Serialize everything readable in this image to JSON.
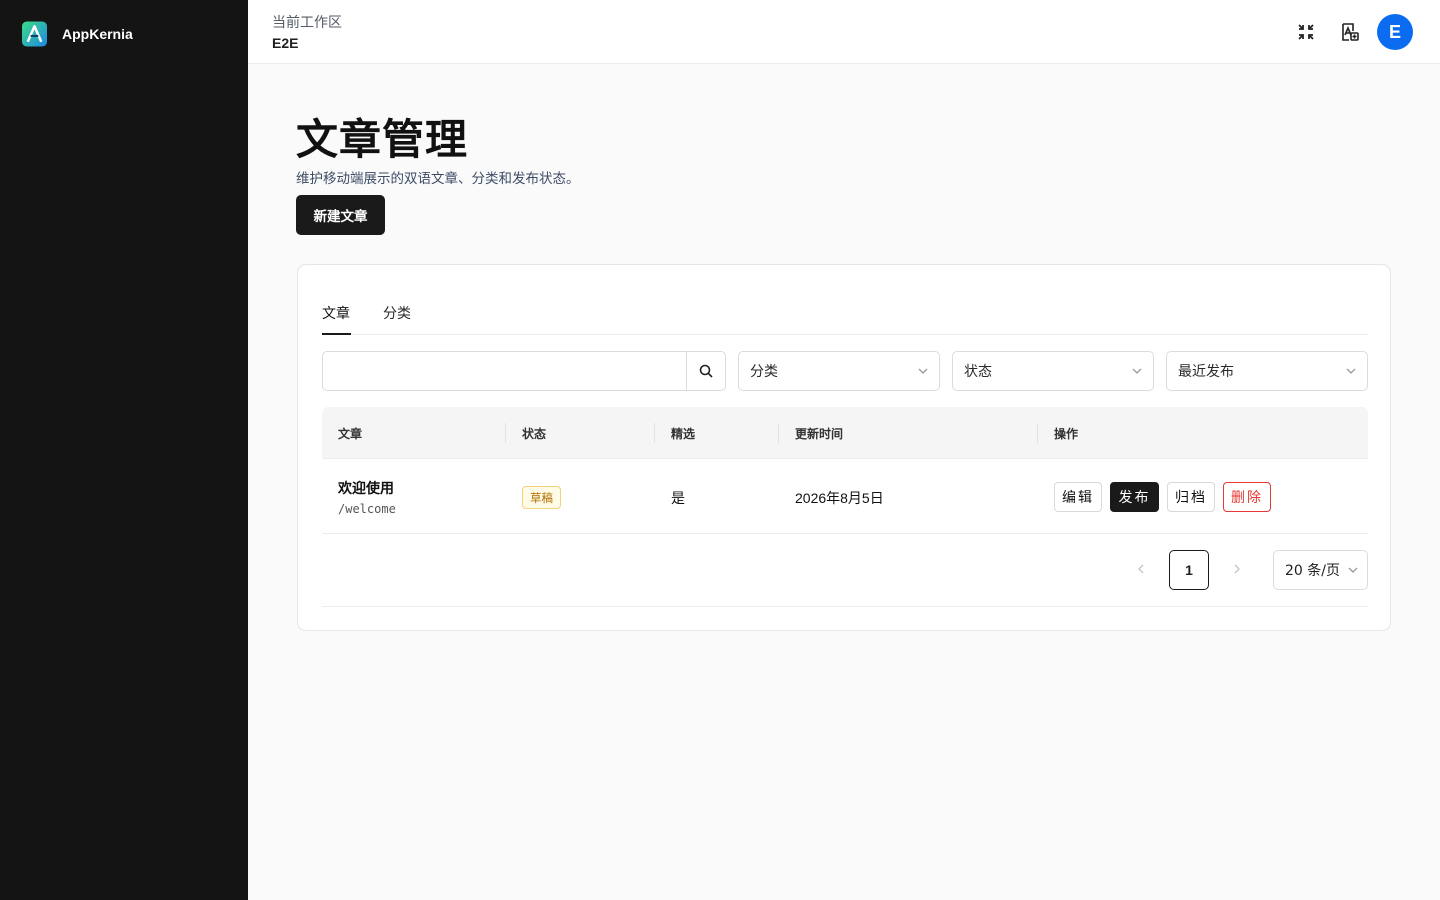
{
  "sidebar": {
    "brand": "AppKernia",
    "logo_icon": "appkernia-logo"
  },
  "header": {
    "workspace_label": "当前工作区",
    "workspace_name": "E2E",
    "icons": [
      "fullscreen-icon",
      "translate-icon"
    ],
    "avatar_letter": "E",
    "avatar_color": "#0b6cf2"
  },
  "page": {
    "title": "文章管理",
    "description": "维护移动端展示的双语文章、分类和发布状态。",
    "new_button": "新建文章"
  },
  "tabs": [
    {
      "label": "文章",
      "active": true
    },
    {
      "label": "分类",
      "active": false
    }
  ],
  "filters": {
    "search_placeholder": "",
    "category": "分类",
    "status": "状态",
    "sort": "最近发布"
  },
  "table": {
    "columns": [
      "文章",
      "状态",
      "精选",
      "更新时间",
      "操作"
    ],
    "rows": [
      {
        "title": "欢迎使用",
        "slug": "/welcome",
        "status": "草稿",
        "featured": "是",
        "updated": "2026年8月5日",
        "actions": [
          "编辑",
          "发布",
          "归档",
          "删除"
        ]
      }
    ]
  },
  "pagination": {
    "current": "1",
    "page_size": "20 条/页"
  },
  "colors": {
    "sidebar": "#141414",
    "primary": "#1a1a1a",
    "danger": "#e53935",
    "draft_badge": "#b06f00"
  }
}
